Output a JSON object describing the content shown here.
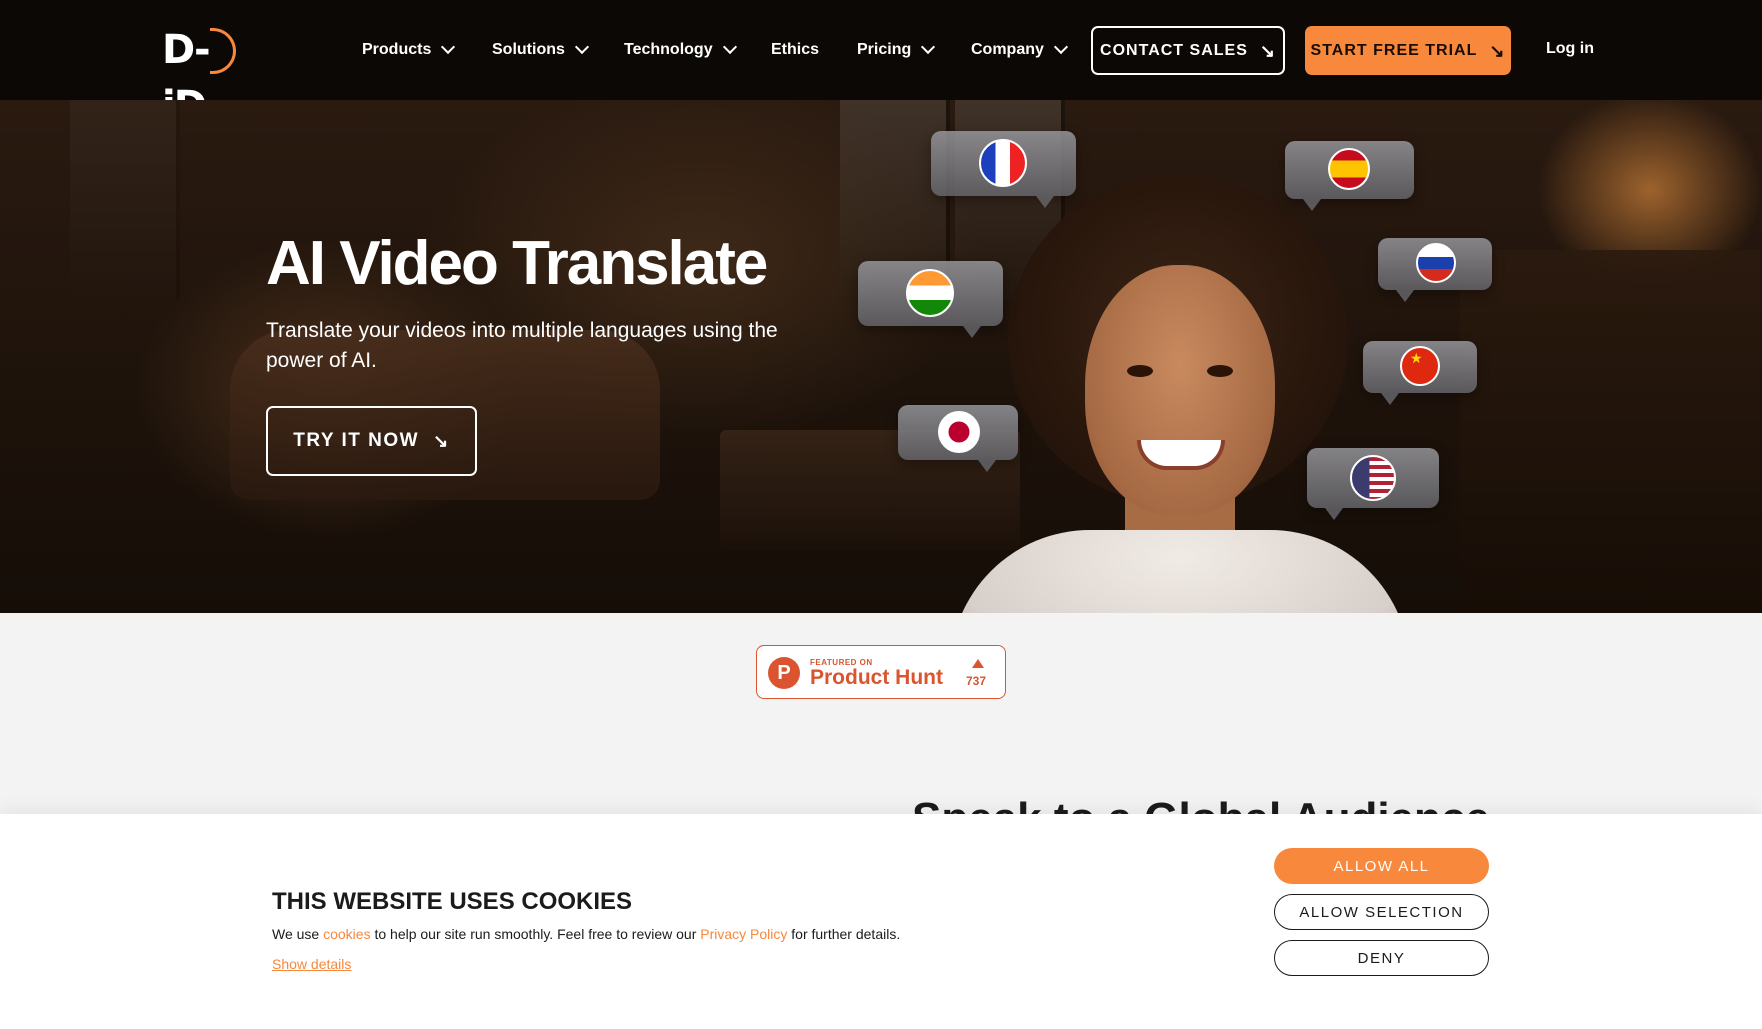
{
  "nav": {
    "logo_text": "D-iD",
    "items": [
      {
        "label": "Products",
        "has_dropdown": true
      },
      {
        "label": "Solutions",
        "has_dropdown": true
      },
      {
        "label": "Technology",
        "has_dropdown": true
      },
      {
        "label": "Ethics",
        "has_dropdown": false
      },
      {
        "label": "Pricing",
        "has_dropdown": true
      },
      {
        "label": "Company",
        "has_dropdown": true
      }
    ],
    "contact_sales": "CONTACT SALES",
    "start_trial": "START FREE TRIAL",
    "login": "Log in"
  },
  "hero": {
    "title": "AI Video Translate",
    "subtitle": "Translate your videos into multiple languages using the power of AI.",
    "cta": "TRY IT NOW",
    "flags": [
      "france-flag-icon",
      "spain-flag-icon",
      "india-flag-icon",
      "russia-flag-icon",
      "china-flag-icon",
      "japan-flag-icon",
      "usa-flag-icon"
    ]
  },
  "product_hunt": {
    "featured": "FEATURED ON",
    "name": "Product Hunt",
    "count": "737"
  },
  "section": {
    "heading_partial": "Speak to a Global Audience"
  },
  "cookie": {
    "title": "THIS WEBSITE USES COOKIES",
    "text_1": "We use ",
    "link_cookies": "cookies",
    "text_2": " to help our site run smoothly. Feel free to review our ",
    "link_privacy": "Privacy Policy",
    "text_3": " for further details.",
    "show_details": "Show details",
    "allow_all": "ALLOW ALL",
    "allow_selection": "ALLOW SELECTION",
    "deny": "DENY"
  },
  "colors": {
    "accent": "#f7883c",
    "nav_bg": "#0c0806",
    "product_hunt": "#da552f"
  }
}
